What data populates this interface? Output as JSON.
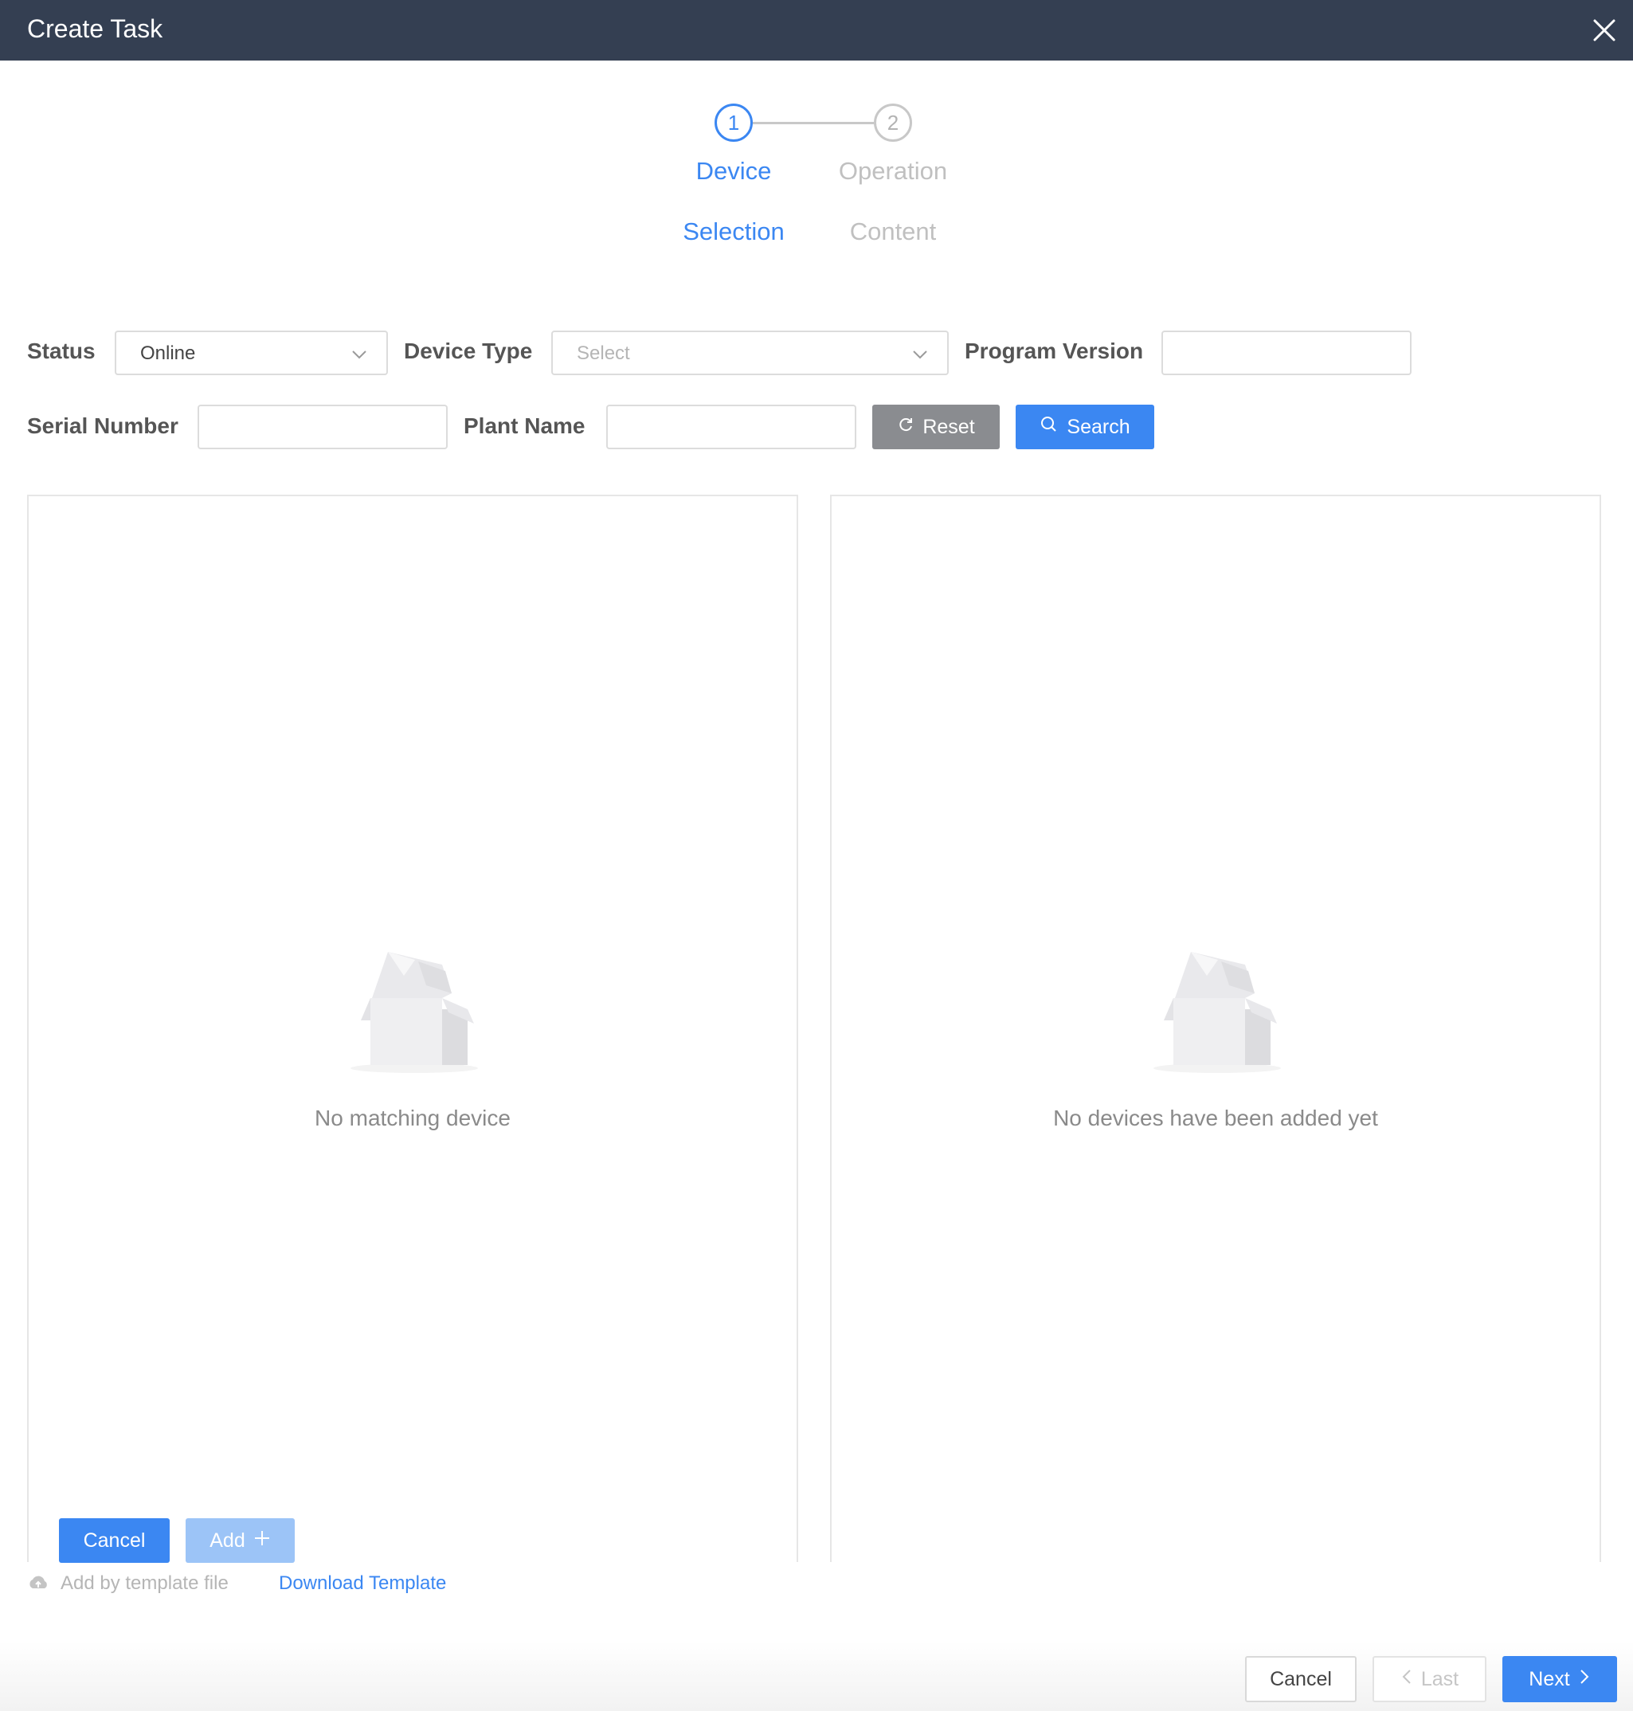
{
  "window": {
    "title": "Create Task"
  },
  "steps": [
    {
      "number": "1",
      "line1": "Device",
      "line2": "Selection",
      "state": "active"
    },
    {
      "number": "2",
      "line1": "Operation",
      "line2": "Content",
      "state": "inactive"
    }
  ],
  "filters": {
    "status_label": "Status",
    "status_value": "Online",
    "device_type_label": "Device Type",
    "device_type_placeholder": "Select",
    "program_version_label": "Program Version",
    "program_version_value": "",
    "serial_number_label": "Serial Number",
    "serial_number_value": "",
    "plant_name_label": "Plant Name",
    "plant_name_value": "",
    "reset_label": "Reset",
    "search_label": "Search"
  },
  "left_panel": {
    "empty_text": "No matching device",
    "cancel_label": "Cancel",
    "add_label": "Add"
  },
  "right_panel": {
    "empty_text": "No devices have been added yet"
  },
  "template": {
    "upload_text": "Add by template file",
    "download_label": "Download Template"
  },
  "footer": {
    "cancel_label": "Cancel",
    "last_label": "Last",
    "next_label": "Next"
  },
  "colors": {
    "titlebar": "#343f52",
    "primary": "#3b87f2",
    "primary_disabled": "#9cc4f7",
    "reset_gray": "#8a8c90"
  },
  "icons": [
    "close-icon",
    "chevron-down-icon",
    "refresh-icon",
    "search-icon",
    "empty-box-icon",
    "plus-icon",
    "cloud-upload-icon",
    "chevron-left-icon",
    "chevron-right-icon"
  ]
}
